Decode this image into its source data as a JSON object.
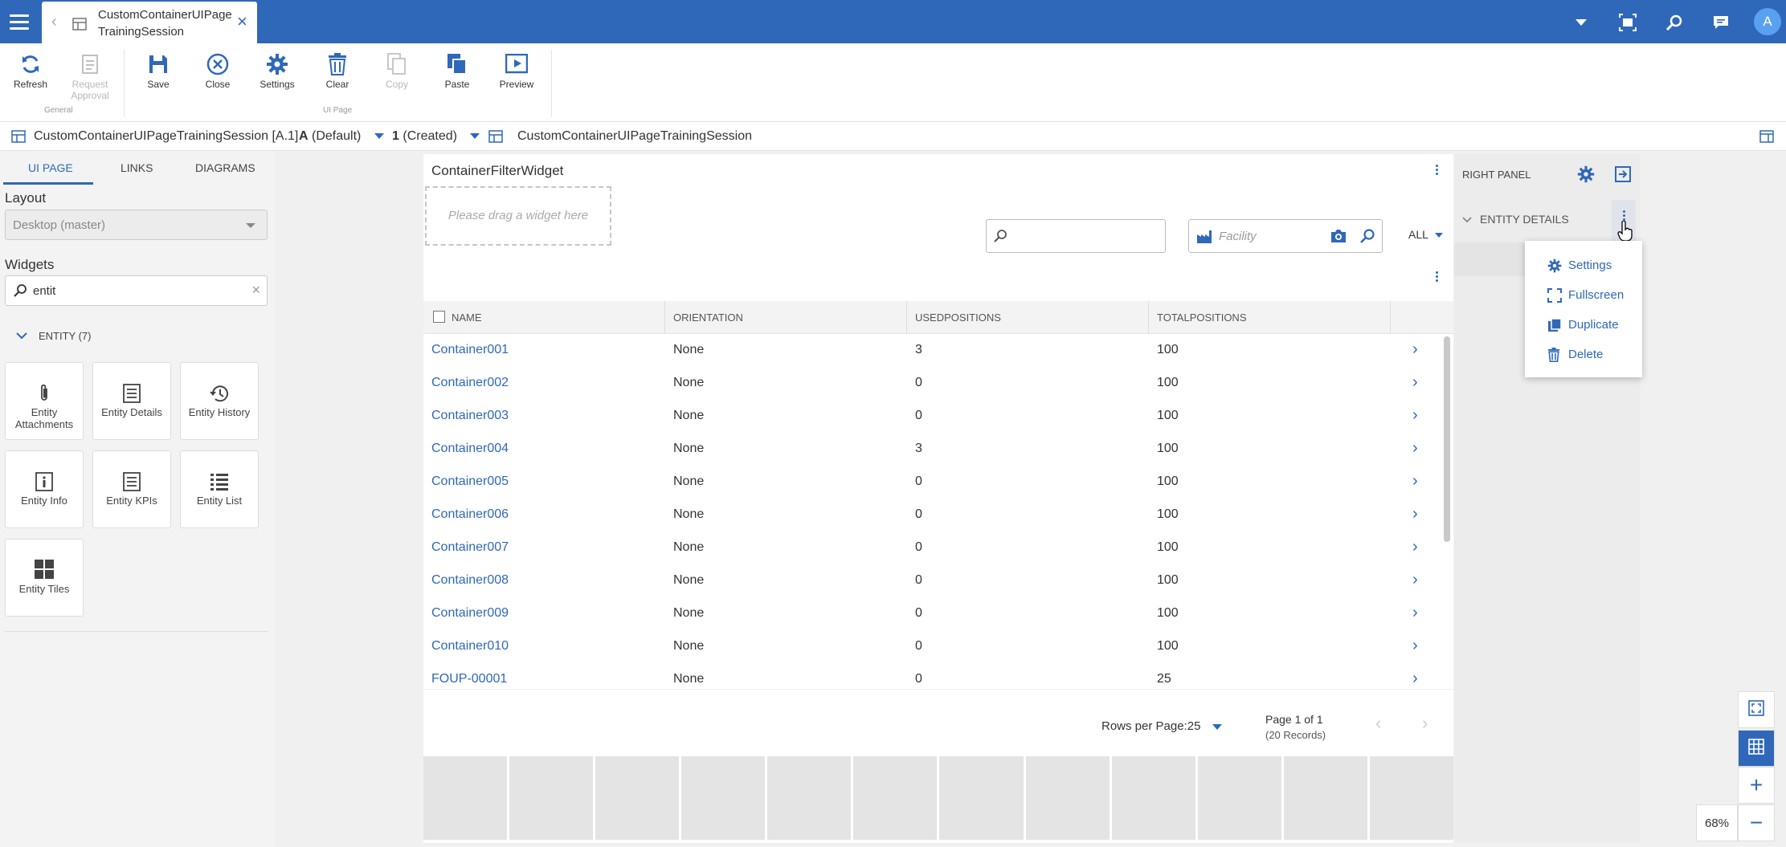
{
  "topbar": {
    "tab_title": "CustomContainerUIPageTrainingSession",
    "avatar_initial": "A"
  },
  "ribbon": {
    "refresh": "Refresh",
    "request_approval": "Request Approval",
    "save": "Save",
    "close": "Close",
    "settings": "Settings",
    "clear": "Clear",
    "copy": "Copy",
    "paste": "Paste",
    "preview": "Preview",
    "group_general": "General",
    "group_ui_page": "UI Page"
  },
  "breadcrumb": {
    "entity": "CustomContainerUIPageTrainingSession [A.1]",
    "version": "A",
    "version_state": "(Default)",
    "revision": "1",
    "revision_state": "(Created)",
    "page": "CustomContainerUIPageTrainingSession"
  },
  "left_panel": {
    "tabs": [
      "UI PAGE",
      "LINKS",
      "DIAGRAMS"
    ],
    "layout_label": "Layout",
    "layout_value": "Desktop (master)",
    "widgets_label": "Widgets",
    "widgets_search": "entit",
    "group": "ENTITY (7)",
    "tiles": [
      {
        "label": "Entity Attachments",
        "icon": "paperclip-icon"
      },
      {
        "label": "Entity Details",
        "icon": "details-icon"
      },
      {
        "label": "Entity History",
        "icon": "history-icon"
      },
      {
        "label": "Entity Info",
        "icon": "info-icon"
      },
      {
        "label": "Entity KPIs",
        "icon": "kpi-icon"
      },
      {
        "label": "Entity List",
        "icon": "list-icon"
      },
      {
        "label": "Entity Tiles",
        "icon": "tiles-icon"
      }
    ]
  },
  "widget": {
    "title": "ContainerFilterWidget",
    "dropzone": "Please drag a widget here",
    "facility_placeholder": "Facility",
    "filter_all": "ALL",
    "columns": [
      "NAME",
      "ORIENTATION",
      "USEDPOSITIONS",
      "TOTALPOSITIONS"
    ],
    "rows": [
      {
        "name": "Container001",
        "orientation": "None",
        "used": "3",
        "total": "100"
      },
      {
        "name": "Container002",
        "orientation": "None",
        "used": "0",
        "total": "100"
      },
      {
        "name": "Container003",
        "orientation": "None",
        "used": "0",
        "total": "100"
      },
      {
        "name": "Container004",
        "orientation": "None",
        "used": "3",
        "total": "100"
      },
      {
        "name": "Container005",
        "orientation": "None",
        "used": "0",
        "total": "100"
      },
      {
        "name": "Container006",
        "orientation": "None",
        "used": "0",
        "total": "100"
      },
      {
        "name": "Container007",
        "orientation": "None",
        "used": "0",
        "total": "100"
      },
      {
        "name": "Container008",
        "orientation": "None",
        "used": "0",
        "total": "100"
      },
      {
        "name": "Container009",
        "orientation": "None",
        "used": "0",
        "total": "100"
      },
      {
        "name": "Container010",
        "orientation": "None",
        "used": "0",
        "total": "100"
      },
      {
        "name": "FOUP-00001",
        "orientation": "None",
        "used": "0",
        "total": "25"
      }
    ],
    "rows_per_page": "Rows per Page:25",
    "page_info": "Page 1 of 1",
    "records": "(20 Records)"
  },
  "right_panel": {
    "title": "RIGHT PANEL",
    "section": "ENTITY DETAILS",
    "menu": [
      "Settings",
      "Fullscreen",
      "Duplicate",
      "Delete"
    ]
  },
  "zoom": {
    "level": "68%"
  },
  "colors": {
    "brand": "#2f68b9",
    "link": "#2f68b9"
  }
}
